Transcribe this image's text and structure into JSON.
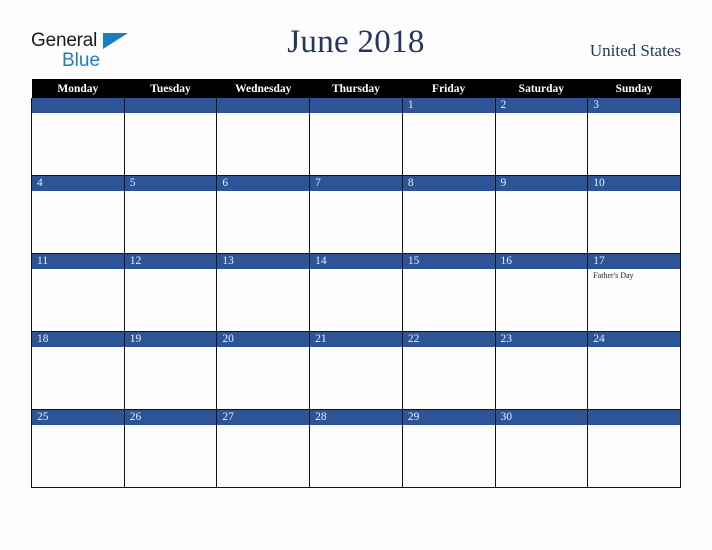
{
  "logo": {
    "word_one": "General",
    "word_two": "Blue",
    "triangle_icon": "triangle-icon",
    "accent_color": "#1a7fc1"
  },
  "header": {
    "title": "June 2018",
    "country": "United States",
    "title_color": "#22365e"
  },
  "calendar": {
    "weekday_headers": [
      "Monday",
      "Tuesday",
      "Wednesday",
      "Thursday",
      "Friday",
      "Saturday",
      "Sunday"
    ],
    "header_bg": "#000000",
    "daybar_bg": "#2d5496",
    "weeks": [
      [
        {
          "day": "",
          "events": []
        },
        {
          "day": "",
          "events": []
        },
        {
          "day": "",
          "events": []
        },
        {
          "day": "",
          "events": []
        },
        {
          "day": "1",
          "events": []
        },
        {
          "day": "2",
          "events": []
        },
        {
          "day": "3",
          "events": []
        }
      ],
      [
        {
          "day": "4",
          "events": []
        },
        {
          "day": "5",
          "events": []
        },
        {
          "day": "6",
          "events": []
        },
        {
          "day": "7",
          "events": []
        },
        {
          "day": "8",
          "events": []
        },
        {
          "day": "9",
          "events": []
        },
        {
          "day": "10",
          "events": []
        }
      ],
      [
        {
          "day": "11",
          "events": []
        },
        {
          "day": "12",
          "events": []
        },
        {
          "day": "13",
          "events": []
        },
        {
          "day": "14",
          "events": []
        },
        {
          "day": "15",
          "events": []
        },
        {
          "day": "16",
          "events": []
        },
        {
          "day": "17",
          "events": [
            "Father's Day"
          ]
        }
      ],
      [
        {
          "day": "18",
          "events": []
        },
        {
          "day": "19",
          "events": []
        },
        {
          "day": "20",
          "events": []
        },
        {
          "day": "21",
          "events": []
        },
        {
          "day": "22",
          "events": []
        },
        {
          "day": "23",
          "events": []
        },
        {
          "day": "24",
          "events": []
        }
      ],
      [
        {
          "day": "25",
          "events": []
        },
        {
          "day": "26",
          "events": []
        },
        {
          "day": "27",
          "events": []
        },
        {
          "day": "28",
          "events": []
        },
        {
          "day": "29",
          "events": []
        },
        {
          "day": "30",
          "events": []
        },
        {
          "day": "",
          "events": []
        }
      ]
    ]
  }
}
